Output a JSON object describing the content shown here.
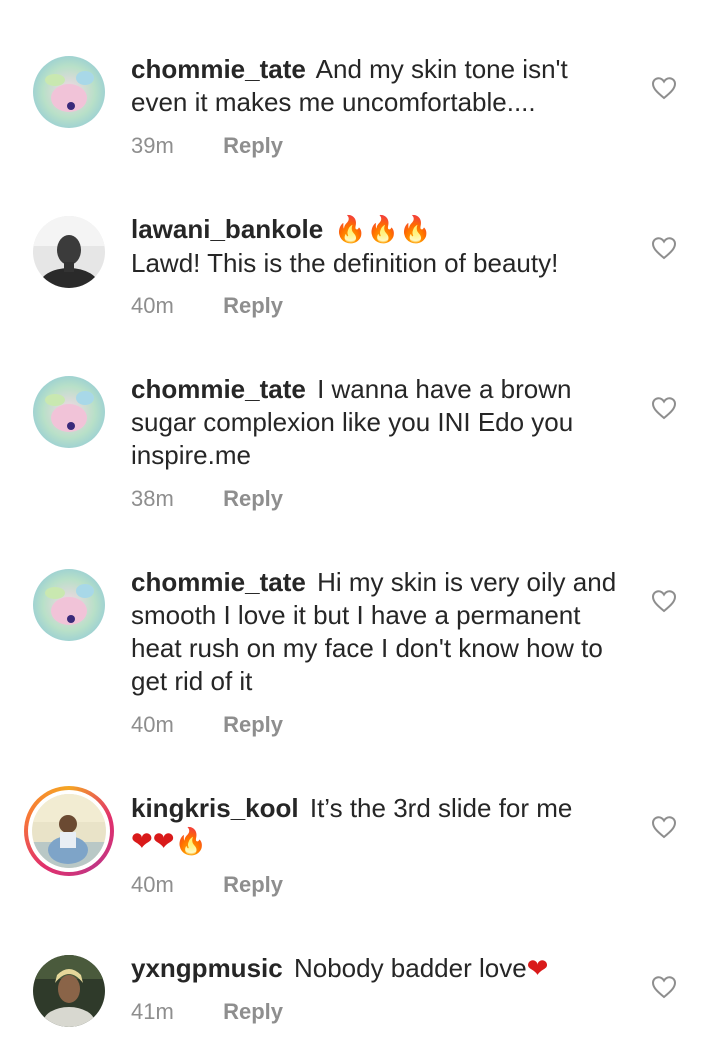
{
  "comments": [
    {
      "username": "chommie_tate",
      "text": "And my skin tone isn't even it makes me uncomfortable....",
      "time": "39m",
      "reply": "Reply",
      "avatar": "flower-avatar",
      "story_ring": false
    },
    {
      "username": "lawani_bankole",
      "text": "Lawd! This is the definition of beauty!",
      "emoji": "🔥🔥🔥",
      "time": "40m",
      "reply": "Reply",
      "avatar": "man-bw-avatar",
      "story_ring": false
    },
    {
      "username": "chommie_tate",
      "text": "I wanna have a brown sugar complexion like you INI Edo you inspire.me",
      "time": "38m",
      "reply": "Reply",
      "avatar": "flower-avatar",
      "story_ring": false
    },
    {
      "username": "chommie_tate",
      "text": "Hi my skin is very oily and smooth I love it but I have a permanent heat rush on my face I don't know how to get rid of it",
      "time": "40m",
      "reply": "Reply",
      "avatar": "flower-avatar",
      "story_ring": false
    },
    {
      "username": "kingkris_kool",
      "text": "It’s the 3rd slide for me",
      "emoji_hearts": "❤❤",
      "emoji_fire": "🔥",
      "time": "40m",
      "reply": "Reply",
      "avatar": "man-sitting-avatar",
      "story_ring": true
    },
    {
      "username": "yxngpmusic",
      "text": "Nobody badder love",
      "emoji_heart": "❤",
      "time": "41m",
      "reply": "Reply",
      "avatar": "man-dreads-avatar",
      "story_ring": false
    }
  ],
  "icons": {
    "like": "heart-outline-icon"
  },
  "colors": {
    "text": "#262626",
    "meta": "#8e8e8e",
    "heart_outline": "#8e8e8e"
  }
}
